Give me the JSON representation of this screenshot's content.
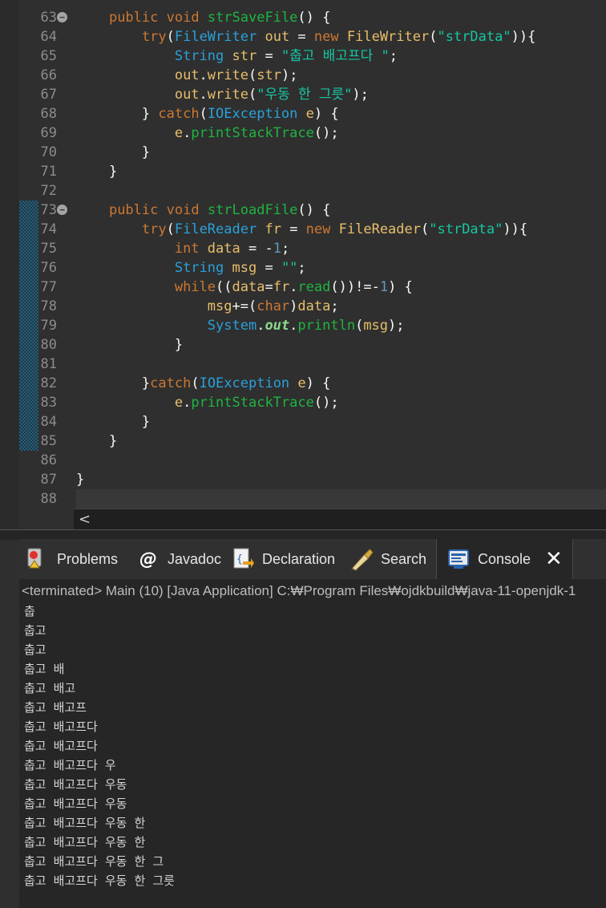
{
  "editor": {
    "lines": [
      {
        "num": "63",
        "tokens": [
          [
            "",
            "    "
          ],
          [
            "k",
            "public"
          ],
          [
            "p",
            " "
          ],
          [
            "k",
            "void"
          ],
          [
            "p",
            " "
          ],
          [
            "m",
            "strSaveFile"
          ],
          [
            "p",
            "() {"
          ]
        ]
      },
      {
        "num": "64",
        "tokens": [
          [
            "",
            "        "
          ],
          [
            "k",
            "try"
          ],
          [
            "p",
            "("
          ],
          [
            "t",
            "FileWriter"
          ],
          [
            "p",
            " "
          ],
          [
            "f",
            "out"
          ],
          [
            "p",
            " = "
          ],
          [
            "k",
            "new"
          ],
          [
            "p",
            " "
          ],
          [
            "f",
            "FileWriter"
          ],
          [
            "p",
            "("
          ],
          [
            "s",
            "\"strData\""
          ],
          [
            "p",
            "))"
          ],
          [
            "p",
            "{"
          ]
        ]
      },
      {
        "num": "65",
        "tokens": [
          [
            "",
            "            "
          ],
          [
            "t",
            "String"
          ],
          [
            "p",
            " "
          ],
          [
            "f",
            "str"
          ],
          [
            "p",
            " = "
          ],
          [
            "s",
            "\"춥고 배고프다 \""
          ],
          [
            "p",
            ";"
          ]
        ]
      },
      {
        "num": "66",
        "tokens": [
          [
            "",
            "            "
          ],
          [
            "f",
            "out"
          ],
          [
            "p",
            "."
          ],
          [
            "f",
            "write"
          ],
          [
            "p",
            "("
          ],
          [
            "f",
            "str"
          ],
          [
            "p",
            ");"
          ]
        ]
      },
      {
        "num": "67",
        "tokens": [
          [
            "",
            "            "
          ],
          [
            "f",
            "out"
          ],
          [
            "p",
            "."
          ],
          [
            "f",
            "write"
          ],
          [
            "p",
            "("
          ],
          [
            "s",
            "\"우동 한 그릇\""
          ],
          [
            "p",
            ");"
          ]
        ]
      },
      {
        "num": "68",
        "tokens": [
          [
            "",
            "        "
          ],
          [
            "p",
            "} "
          ],
          [
            "k",
            "catch"
          ],
          [
            "p",
            "("
          ],
          [
            "t",
            "IOException"
          ],
          [
            "p",
            " "
          ],
          [
            "f",
            "e"
          ],
          [
            "p",
            ") {"
          ]
        ]
      },
      {
        "num": "69",
        "tokens": [
          [
            "",
            "            "
          ],
          [
            "f",
            "e"
          ],
          [
            "p",
            "."
          ],
          [
            "m",
            "printStackTrace"
          ],
          [
            "p",
            "();"
          ]
        ]
      },
      {
        "num": "70",
        "tokens": [
          [
            "",
            "        "
          ],
          [
            "p",
            "}"
          ]
        ]
      },
      {
        "num": "71",
        "tokens": [
          [
            "",
            "    "
          ],
          [
            "p",
            "}"
          ]
        ]
      },
      {
        "num": "72",
        "tokens": []
      },
      {
        "num": "73",
        "tokens": [
          [
            "",
            "    "
          ],
          [
            "k",
            "public"
          ],
          [
            "p",
            " "
          ],
          [
            "k",
            "void"
          ],
          [
            "p",
            " "
          ],
          [
            "m",
            "strLoadFile"
          ],
          [
            "p",
            "() {"
          ]
        ]
      },
      {
        "num": "74",
        "tokens": [
          [
            "",
            "        "
          ],
          [
            "k",
            "try"
          ],
          [
            "p",
            "("
          ],
          [
            "t",
            "FileReader"
          ],
          [
            "p",
            " "
          ],
          [
            "f",
            "fr"
          ],
          [
            "p",
            " = "
          ],
          [
            "k",
            "new"
          ],
          [
            "p",
            " "
          ],
          [
            "f",
            "FileReader"
          ],
          [
            "p",
            "("
          ],
          [
            "s",
            "\"strData\""
          ],
          [
            "p",
            "))"
          ],
          [
            "p",
            "{"
          ]
        ]
      },
      {
        "num": "75",
        "tokens": [
          [
            "",
            "            "
          ],
          [
            "k",
            "int"
          ],
          [
            "p",
            " "
          ],
          [
            "f",
            "data"
          ],
          [
            "p",
            " = -"
          ],
          [
            "n",
            "1"
          ],
          [
            "p",
            ";"
          ]
        ]
      },
      {
        "num": "76",
        "tokens": [
          [
            "",
            "            "
          ],
          [
            "t",
            "String"
          ],
          [
            "p",
            " "
          ],
          [
            "f",
            "msg"
          ],
          [
            "p",
            " = "
          ],
          [
            "s",
            "\"\""
          ],
          [
            "p",
            ";"
          ]
        ]
      },
      {
        "num": "77",
        "tokens": [
          [
            "",
            "            "
          ],
          [
            "k",
            "while"
          ],
          [
            "p",
            "(("
          ],
          [
            "f",
            "data"
          ],
          [
            "p",
            "="
          ],
          [
            "f",
            "fr"
          ],
          [
            "p",
            "."
          ],
          [
            "m",
            "read"
          ],
          [
            "p",
            "())!=-"
          ],
          [
            "n",
            "1"
          ],
          [
            "p",
            ") {"
          ]
        ]
      },
      {
        "num": "78",
        "tokens": [
          [
            "",
            "                "
          ],
          [
            "f",
            "msg"
          ],
          [
            "p",
            "+=("
          ],
          [
            "k",
            "char"
          ],
          [
            "p",
            ")"
          ],
          [
            "f",
            "data"
          ],
          [
            "p",
            ";"
          ]
        ]
      },
      {
        "num": "79",
        "tokens": [
          [
            "",
            "                "
          ],
          [
            "t",
            "System"
          ],
          [
            "p",
            "."
          ],
          [
            "st",
            "out"
          ],
          [
            "p",
            "."
          ],
          [
            "m",
            "println"
          ],
          [
            "p",
            "("
          ],
          [
            "f",
            "msg"
          ],
          [
            "p",
            ");"
          ]
        ]
      },
      {
        "num": "80",
        "tokens": [
          [
            "",
            "            "
          ],
          [
            "p",
            "}"
          ]
        ]
      },
      {
        "num": "81",
        "tokens": []
      },
      {
        "num": "82",
        "tokens": [
          [
            "",
            "        "
          ],
          [
            "p",
            "}"
          ],
          [
            "k",
            "catch"
          ],
          [
            "p",
            "("
          ],
          [
            "t",
            "IOException"
          ],
          [
            "p",
            " "
          ],
          [
            "f",
            "e"
          ],
          [
            "p",
            ") {"
          ]
        ]
      },
      {
        "num": "83",
        "tokens": [
          [
            "",
            "            "
          ],
          [
            "f",
            "e"
          ],
          [
            "p",
            "."
          ],
          [
            "m",
            "printStackTrace"
          ],
          [
            "p",
            "();"
          ]
        ]
      },
      {
        "num": "84",
        "tokens": [
          [
            "",
            "        "
          ],
          [
            "p",
            "}"
          ]
        ]
      },
      {
        "num": "85",
        "tokens": [
          [
            "",
            "    "
          ],
          [
            "p",
            "}"
          ]
        ]
      },
      {
        "num": "86",
        "tokens": []
      },
      {
        "num": "87",
        "tokens": [
          [
            "p",
            "}"
          ]
        ]
      },
      {
        "num": "88",
        "tokens": []
      }
    ],
    "fold_icon": "−",
    "scroll_left_glyph": "<"
  },
  "tabs": [
    {
      "label": "Problems",
      "icon": "problems-icon"
    },
    {
      "label": "Javadoc",
      "icon": "javadoc-icon"
    },
    {
      "label": "Declaration",
      "icon": "declaration-icon"
    },
    {
      "label": "Search",
      "icon": "search-icon"
    },
    {
      "label": "Console",
      "icon": "console-icon",
      "active": true
    }
  ],
  "close_glyph": "✕",
  "console": {
    "status": "<terminated> Main (10) [Java Application] C:₩Program Files₩ojdkbuild₩java-11-openjdk-1",
    "output": [
      "춥",
      "춥고",
      "춥고",
      "춥고 배",
      "춥고 배고",
      "춥고 배고프",
      "춥고 배고프다",
      "춥고 배고프다",
      "춥고 배고프다 우",
      "춥고 배고프다 우동",
      "춥고 배고프다 우동",
      "춥고 배고프다 우동 한",
      "춥고 배고프다 우동 한",
      "춥고 배고프다 우동 한 그",
      "춥고 배고프다 우동 한 그릇"
    ]
  },
  "colors": {
    "keyword": "#cc7832",
    "type": "#2aa0d9",
    "method": "#1eb540",
    "string": "#17c6a3",
    "number": "#6897bb",
    "field": "#e8bf6a",
    "change_bar": "#2c5a70"
  }
}
